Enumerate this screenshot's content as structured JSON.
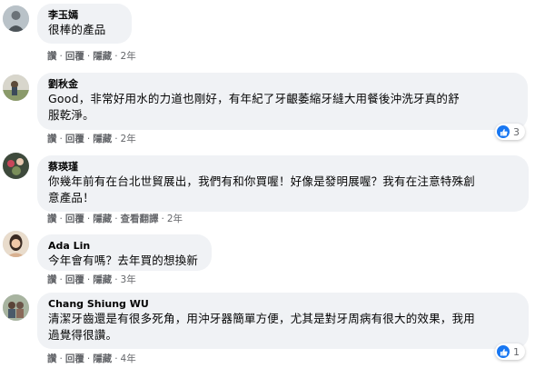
{
  "comments": [
    {
      "author": "李玉嫣",
      "lines": [
        "很棒的產品"
      ],
      "actions": {
        "like": "讚",
        "reply": "回覆",
        "hide": "隱藏",
        "time": "2年"
      }
    },
    {
      "author": "劉秋金",
      "lines": [
        "Good，非常好用水的力道也剛好，有年紀了牙齦萎縮牙縫大用餐後沖洗牙真的舒",
        "服乾淨。"
      ],
      "actions": {
        "like": "讚",
        "reply": "回覆",
        "hide": "隱藏",
        "time": "2年"
      },
      "reactions": {
        "icon": "like-icon",
        "count": "3"
      }
    },
    {
      "author": "蔡瑛瑾",
      "lines": [
        "你幾年前有在台北世貿展出，我們有和你買喔！好像是發明展喔？我有在注意特殊創",
        "意產品！"
      ],
      "actions": {
        "like": "讚",
        "reply": "回覆",
        "hide": "隱藏",
        "translate": "查看翻譯",
        "time": "2年"
      }
    },
    {
      "author": "Ada Lin",
      "lines": [
        "今年會有嗎？去年買的想換新"
      ],
      "actions": {
        "like": "讚",
        "reply": "回覆",
        "hide": "隱藏",
        "time": "3年"
      }
    },
    {
      "author": "Chang Shiung WU",
      "lines": [
        "清潔牙齒還是有很多死角，用沖牙器簡單方便，尤其是對牙周病有很大的效果，我用",
        "過覺得很讚。"
      ],
      "actions": {
        "like": "讚",
        "reply": "回覆",
        "hide": "隱藏",
        "time": "4年"
      },
      "reactions": {
        "icon": "like-icon",
        "count": "1"
      }
    }
  ],
  "colors": {
    "bubble": "#f0f2f5",
    "meta_text": "#65676b",
    "like_blue": "#1877f2"
  }
}
